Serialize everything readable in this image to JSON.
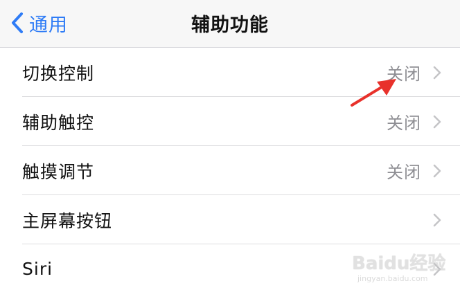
{
  "navbar": {
    "back_label": "通用",
    "title": "辅助功能"
  },
  "rows": [
    {
      "label": "切换控制",
      "value": "关闭"
    },
    {
      "label": "辅助触控",
      "value": "关闭"
    },
    {
      "label": "触摸调节",
      "value": "关闭"
    },
    {
      "label": "主屏幕按钮",
      "value": ""
    },
    {
      "label": "Siri",
      "value": ""
    }
  ],
  "watermark": {
    "brand": "Baidu经验",
    "url": "jingyan.baidu.com"
  },
  "colors": {
    "accent": "#2f7cf6",
    "annotation": "#e8312b"
  },
  "icons": {
    "back": "chevron-left-icon",
    "row": "chevron-right-icon"
  }
}
